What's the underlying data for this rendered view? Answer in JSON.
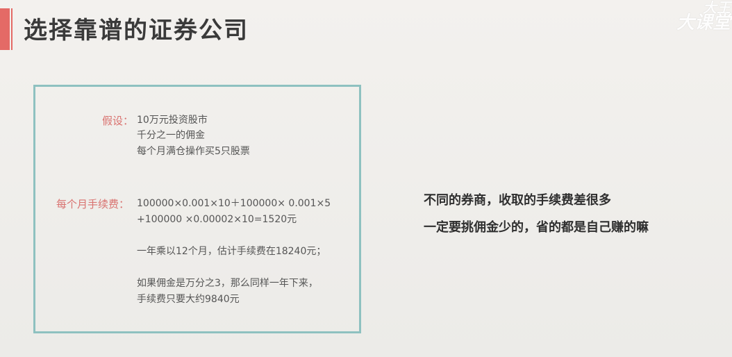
{
  "header": {
    "title": "选择靠谱的证券公司",
    "watermark_line1": "大王",
    "watermark_line2": "大课堂"
  },
  "box": {
    "assumption_label": "假设：",
    "assumption_lines": [
      "10万元投资股市",
      "千分之一的佣金",
      "每个月满仓操作买5只股票"
    ],
    "monthly_fee_label": "每个月手续费：",
    "formula_lines": [
      "100000×0.001×10＋100000× 0.001×5",
      "+100000 ×0.00002×10=1520元"
    ],
    "annual_line": "一年乘以12个月，估计手续费在18240元；",
    "alt_lines": [
      "如果佣金是万分之3，那么同样一年下来，",
      "手续费只要大约9840元"
    ]
  },
  "side_text": {
    "line1": "不同的券商，收取的手续费差很多",
    "line2": "一定要挑佣金少的，省的都是自己赚的嘛"
  },
  "colors": {
    "accent": "#e46a66",
    "panel_border": "#8ec1c0",
    "label": "#d9726f"
  }
}
